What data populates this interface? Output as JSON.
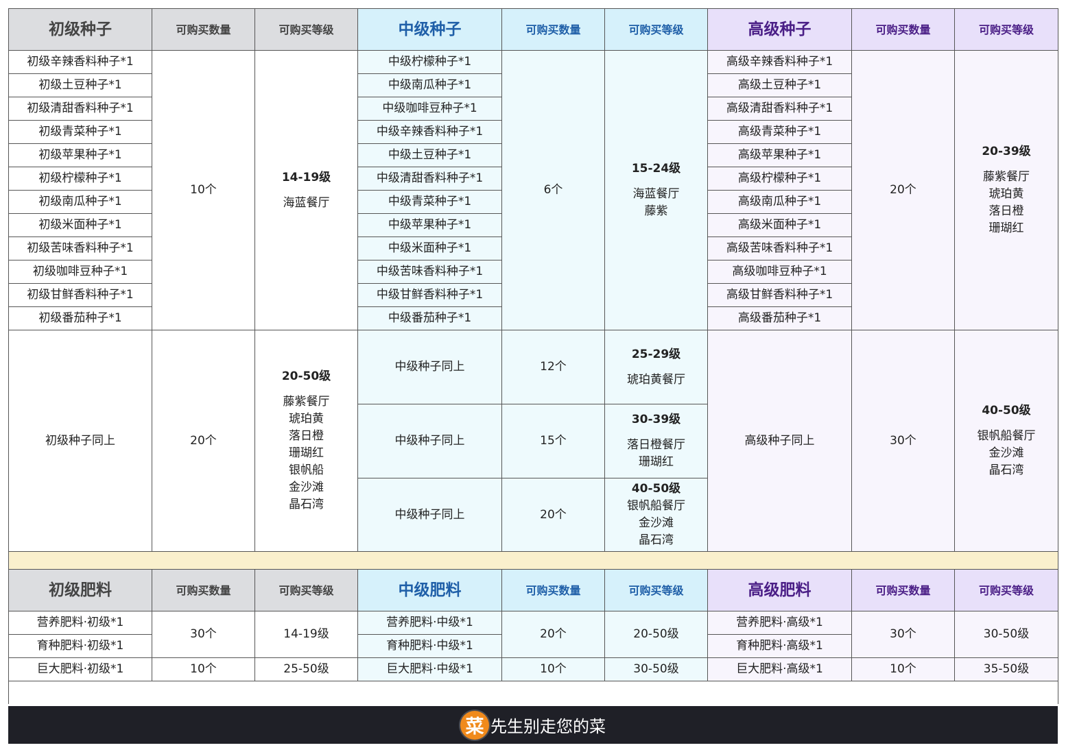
{
  "seeds": {
    "header": {
      "basic": "初级种子",
      "mid": "中级种子",
      "high": "高级种子",
      "qty": "可购买数量",
      "lvl": "可购买等级"
    },
    "basic_items": [
      "初级辛辣香料种子*1",
      "初级土豆种子*1",
      "初级清甜香料种子*1",
      "初级青菜种子*1",
      "初级苹果种子*1",
      "初级柠檬种子*1",
      "初级南瓜种子*1",
      "初级米面种子*1",
      "初级苦味香料种子*1",
      "初级咖啡豆种子*1",
      "初级甘鲜香料种子*1",
      "初级番茄种子*1"
    ],
    "mid_items": [
      "中级柠檬种子*1",
      "中级南瓜种子*1",
      "中级咖啡豆种子*1",
      "中级辛辣香料种子*1",
      "中级土豆种子*1",
      "中级清甜香料种子*1",
      "中级青菜种子*1",
      "中级苹果种子*1",
      "中级米面种子*1",
      "中级苦味香料种子*1",
      "中级甘鲜香料种子*1",
      "中级番茄种子*1"
    ],
    "high_items": [
      "高级辛辣香料种子*1",
      "高级土豆种子*1",
      "高级清甜香料种子*1",
      "高级青菜种子*1",
      "高级苹果种子*1",
      "高级柠檬种子*1",
      "高级南瓜种子*1",
      "高级米面种子*1",
      "高级苦味香料种子*1",
      "高级咖啡豆种子*1",
      "高级甘鲜香料种子*1",
      "高级番茄种子*1"
    ],
    "tier1": {
      "basic_qty": "10个",
      "basic_lvl": "14-19级",
      "basic_lvl_note": "海蓝餐厅",
      "mid_qty": "6个",
      "mid_lvl": "15-24级",
      "mid_lvl_note1": "海蓝餐厅",
      "mid_lvl_note2": "藤紫",
      "high_qty": "20个",
      "high_lvl": "20-39级",
      "high_lvl_notes": [
        "藤紫餐厅",
        "琥珀黄",
        "落日橙",
        "珊瑚红"
      ]
    },
    "tier2": {
      "basic_same": "初级种子同上",
      "basic_qty": "20个",
      "basic_lvl": "20-50级",
      "basic_lvl_notes": [
        "藤紫餐厅",
        "琥珀黄",
        "落日橙",
        "珊瑚红",
        "银帆船",
        "金沙滩",
        "晶石湾"
      ],
      "mid_rows": [
        {
          "same": "中级种子同上",
          "qty": "12个",
          "lvl": "25-29级",
          "notes": [
            "琥珀黄餐厅"
          ]
        },
        {
          "same": "中级种子同上",
          "qty": "15个",
          "lvl": "30-39级",
          "notes": [
            "落日橙餐厅",
            "珊瑚红"
          ]
        },
        {
          "same": "中级种子同上",
          "qty": "20个",
          "lvl": "40-50级",
          "notes": [
            "银帆船餐厅",
            "金沙滩",
            "晶石湾"
          ]
        }
      ],
      "high_same": "高级种子同上",
      "high_qty": "30个",
      "high_lvl": "40-50级",
      "high_lvl_notes": [
        "银帆船餐厅",
        "金沙滩",
        "晶石湾"
      ]
    }
  },
  "fertilizer": {
    "header": {
      "basic": "初级肥料",
      "mid": "中级肥料",
      "high": "高级肥料",
      "qty": "可购买数量",
      "lvl": "可购买等级"
    },
    "basic_items": [
      "营养肥料·初级*1",
      "育种肥料·初级*1",
      "巨大肥料·初级*1"
    ],
    "mid_items": [
      "营养肥料·中级*1",
      "育种肥料·中级*1",
      "巨大肥料·中级*1"
    ],
    "high_items": [
      "营养肥料·高级*1",
      "育种肥料·高级*1",
      "巨大肥料·高级*1"
    ],
    "basic_qty_a": "30个",
    "basic_lvl_a": "14-19级",
    "basic_qty_b": "10个",
    "basic_lvl_b": "25-50级",
    "mid_qty_a": "20个",
    "mid_lvl_a": "20-50级",
    "mid_qty_b": "10个",
    "mid_lvl_b": "30-50级",
    "high_qty_a": "30个",
    "high_lvl_a": "30-50级",
    "high_qty_b": "10个",
    "high_lvl_b": "35-50级"
  },
  "footer": {
    "logo_char": "菜",
    "text": "先生别走您的菜"
  },
  "colors": {
    "header_gray": "#dcdde0",
    "header_blue": "#d6f1fb",
    "header_purple": "#e8e0fa",
    "separator": "#faf0cd",
    "footer_bg": "#1f2027",
    "logo": "#f08a1c"
  }
}
